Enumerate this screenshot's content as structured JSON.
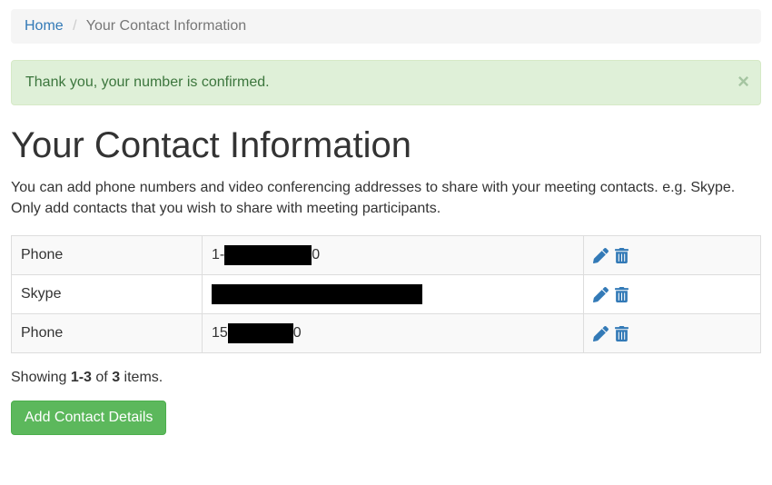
{
  "breadcrumb": {
    "home": "Home",
    "current": "Your Contact Information"
  },
  "alert": {
    "message": "Thank you, your number is confirmed."
  },
  "page": {
    "title": "Your Contact Information",
    "description": "You can add phone numbers and video conferencing addresses to share with your meeting contacts. e.g. Skype. Only add contacts that you wish to share with meeting participants."
  },
  "contacts": [
    {
      "type": "Phone",
      "value_prefix": "1-",
      "value_suffix": "0",
      "redact_w": 96,
      "redact_h": 22
    },
    {
      "type": "Skype",
      "value_prefix": "",
      "value_suffix": "",
      "redact_w": 232,
      "redact_h": 22
    },
    {
      "type": "Phone",
      "value_prefix": "15",
      "value_suffix": "0",
      "redact_w": 72,
      "redact_h": 22
    }
  ],
  "summary": {
    "prefix": "Showing ",
    "range": "1-3",
    "mid": " of ",
    "total": "3",
    "suffix": " items."
  },
  "buttons": {
    "add": "Add Contact Details"
  }
}
